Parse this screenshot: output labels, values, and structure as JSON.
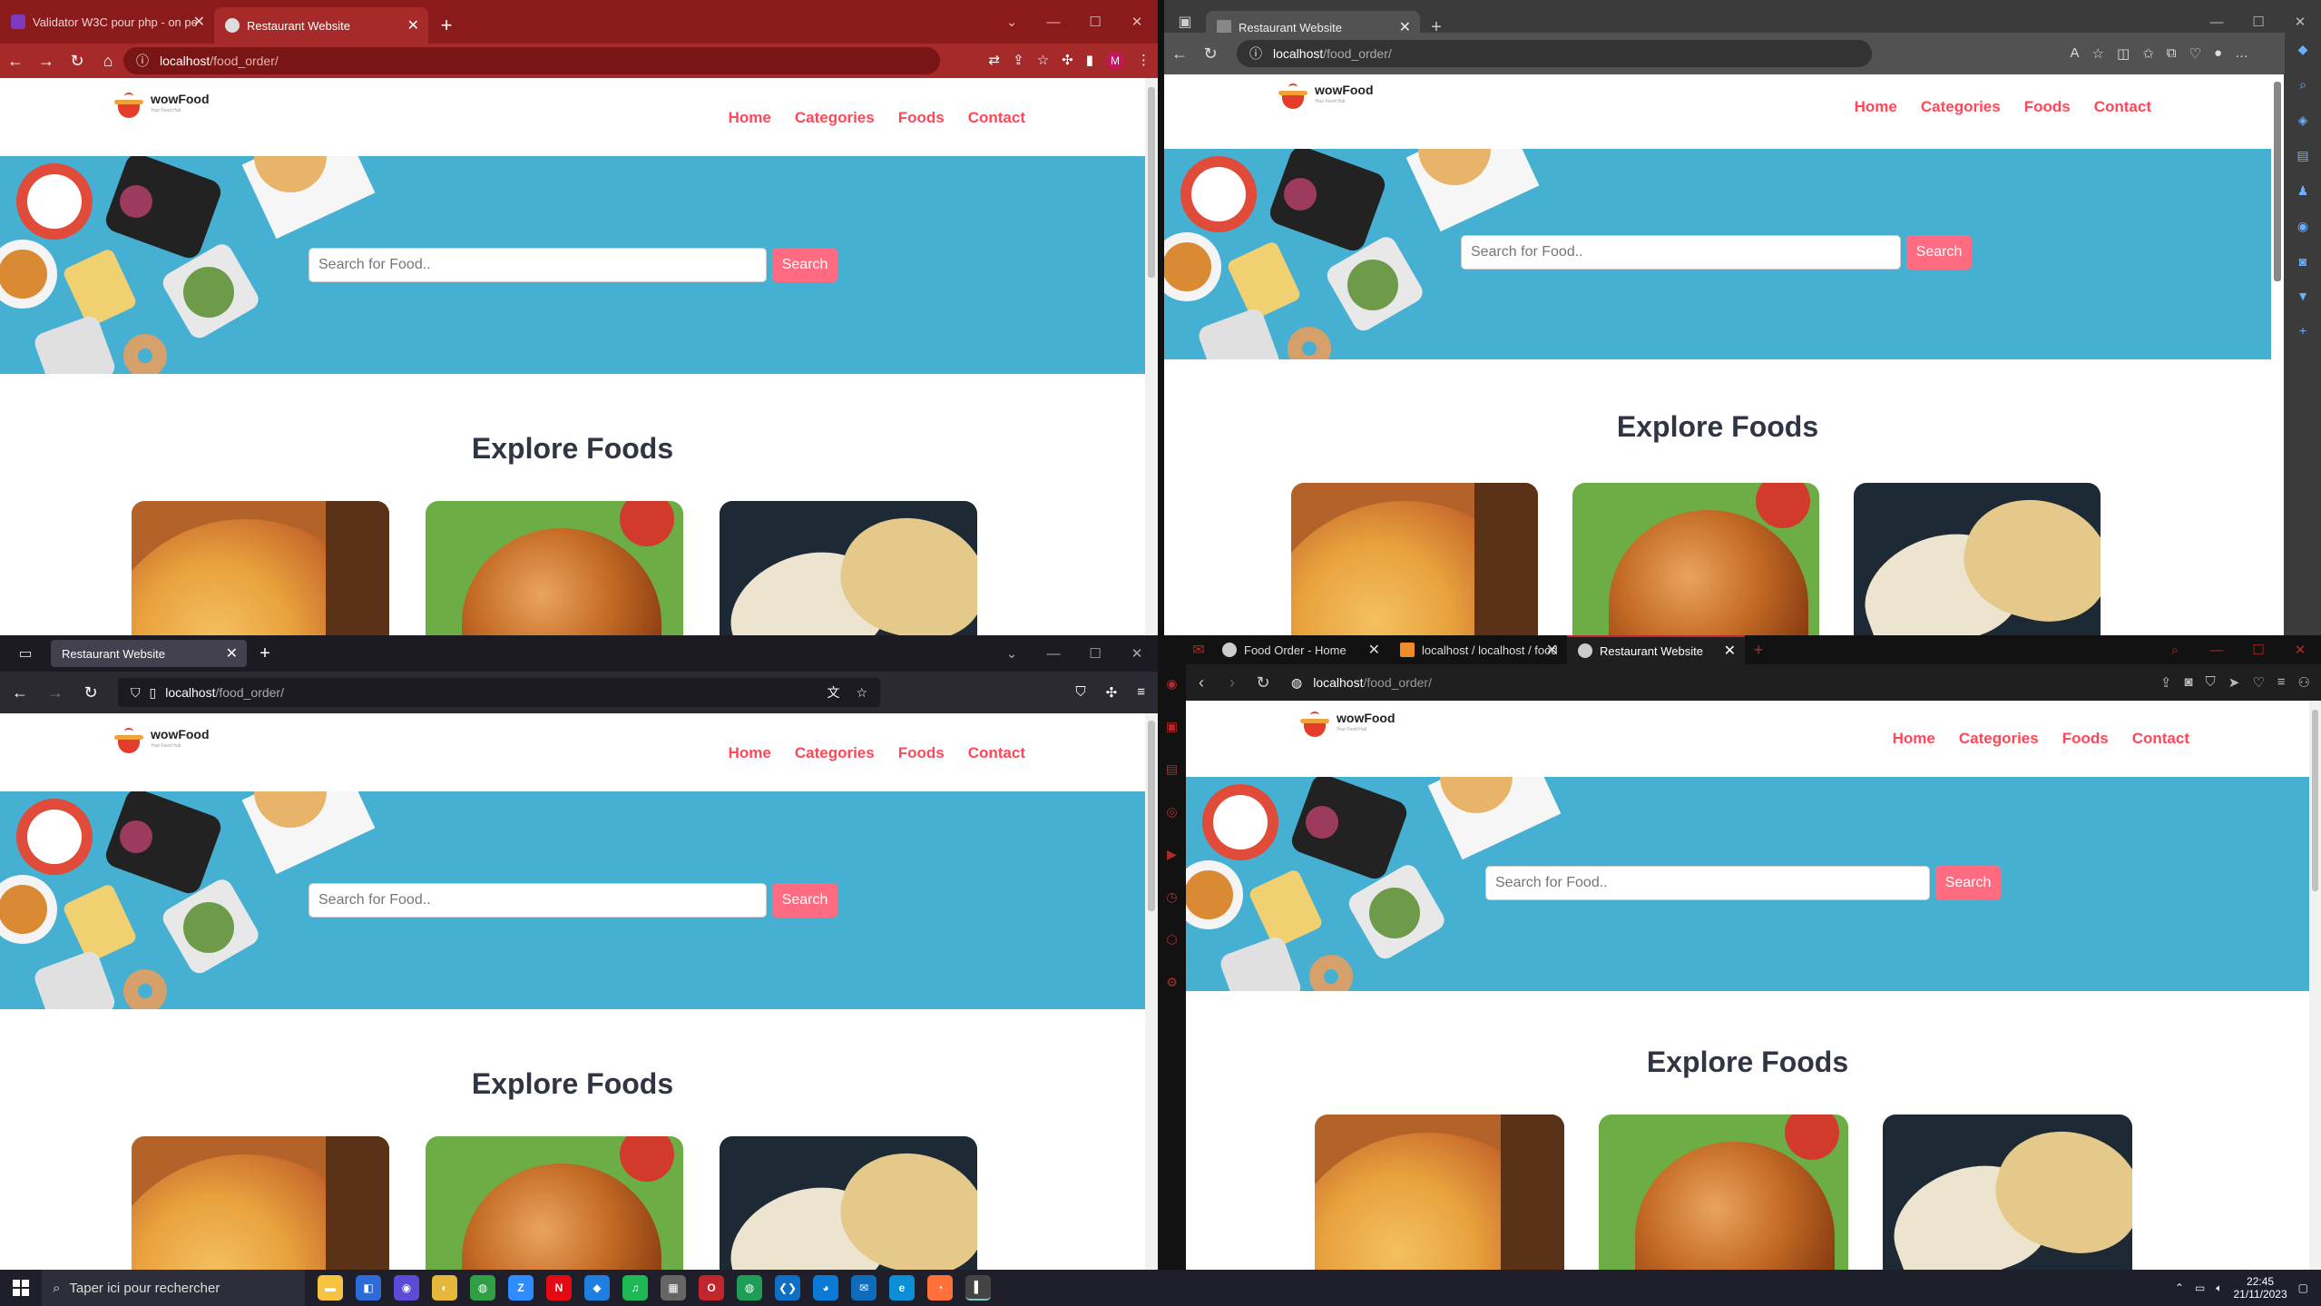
{
  "site": {
    "logo_text": "wowFood",
    "logo_tagline": "Your Food Hub",
    "nav": [
      "Home",
      "Categories",
      "Foods",
      "Contact"
    ],
    "search_placeholder": "Search for Food..",
    "search_button": "Search",
    "section_title": "Explore Foods"
  },
  "chrome_window": {
    "tabs": [
      {
        "title": "Validator W3C pour php - on pe",
        "active": false
      },
      {
        "title": "Restaurant Website",
        "active": true
      }
    ],
    "url_host": "localhost",
    "url_path": "/food_order/",
    "profile_initial": "M",
    "accent": "#8b1a1a"
  },
  "edge_window": {
    "tabs": [
      {
        "title": "Restaurant Website",
        "active": true
      }
    ],
    "url_host": "localhost",
    "url_path": "/food_order/"
  },
  "firefox_window": {
    "tabs": [
      {
        "title": "Restaurant Website",
        "active": true
      }
    ],
    "url_host": "localhost",
    "url_path": "/food_order/"
  },
  "opera_window": {
    "tabs": [
      {
        "title": "Food Order - Home",
        "active": false
      },
      {
        "title": "localhost / localhost / food",
        "active": false
      },
      {
        "title": "Restaurant Website",
        "active": true
      }
    ],
    "url_host": "localhost",
    "url_path": "/food_order/"
  },
  "taskbar": {
    "search_placeholder": "Taper ici pour rechercher",
    "time": "22:45",
    "date": "21/11/2023"
  },
  "colors": {
    "hero_bg": "#45b0d2",
    "brand_red": "#ff4757",
    "search_btn": "#ff6b81"
  }
}
